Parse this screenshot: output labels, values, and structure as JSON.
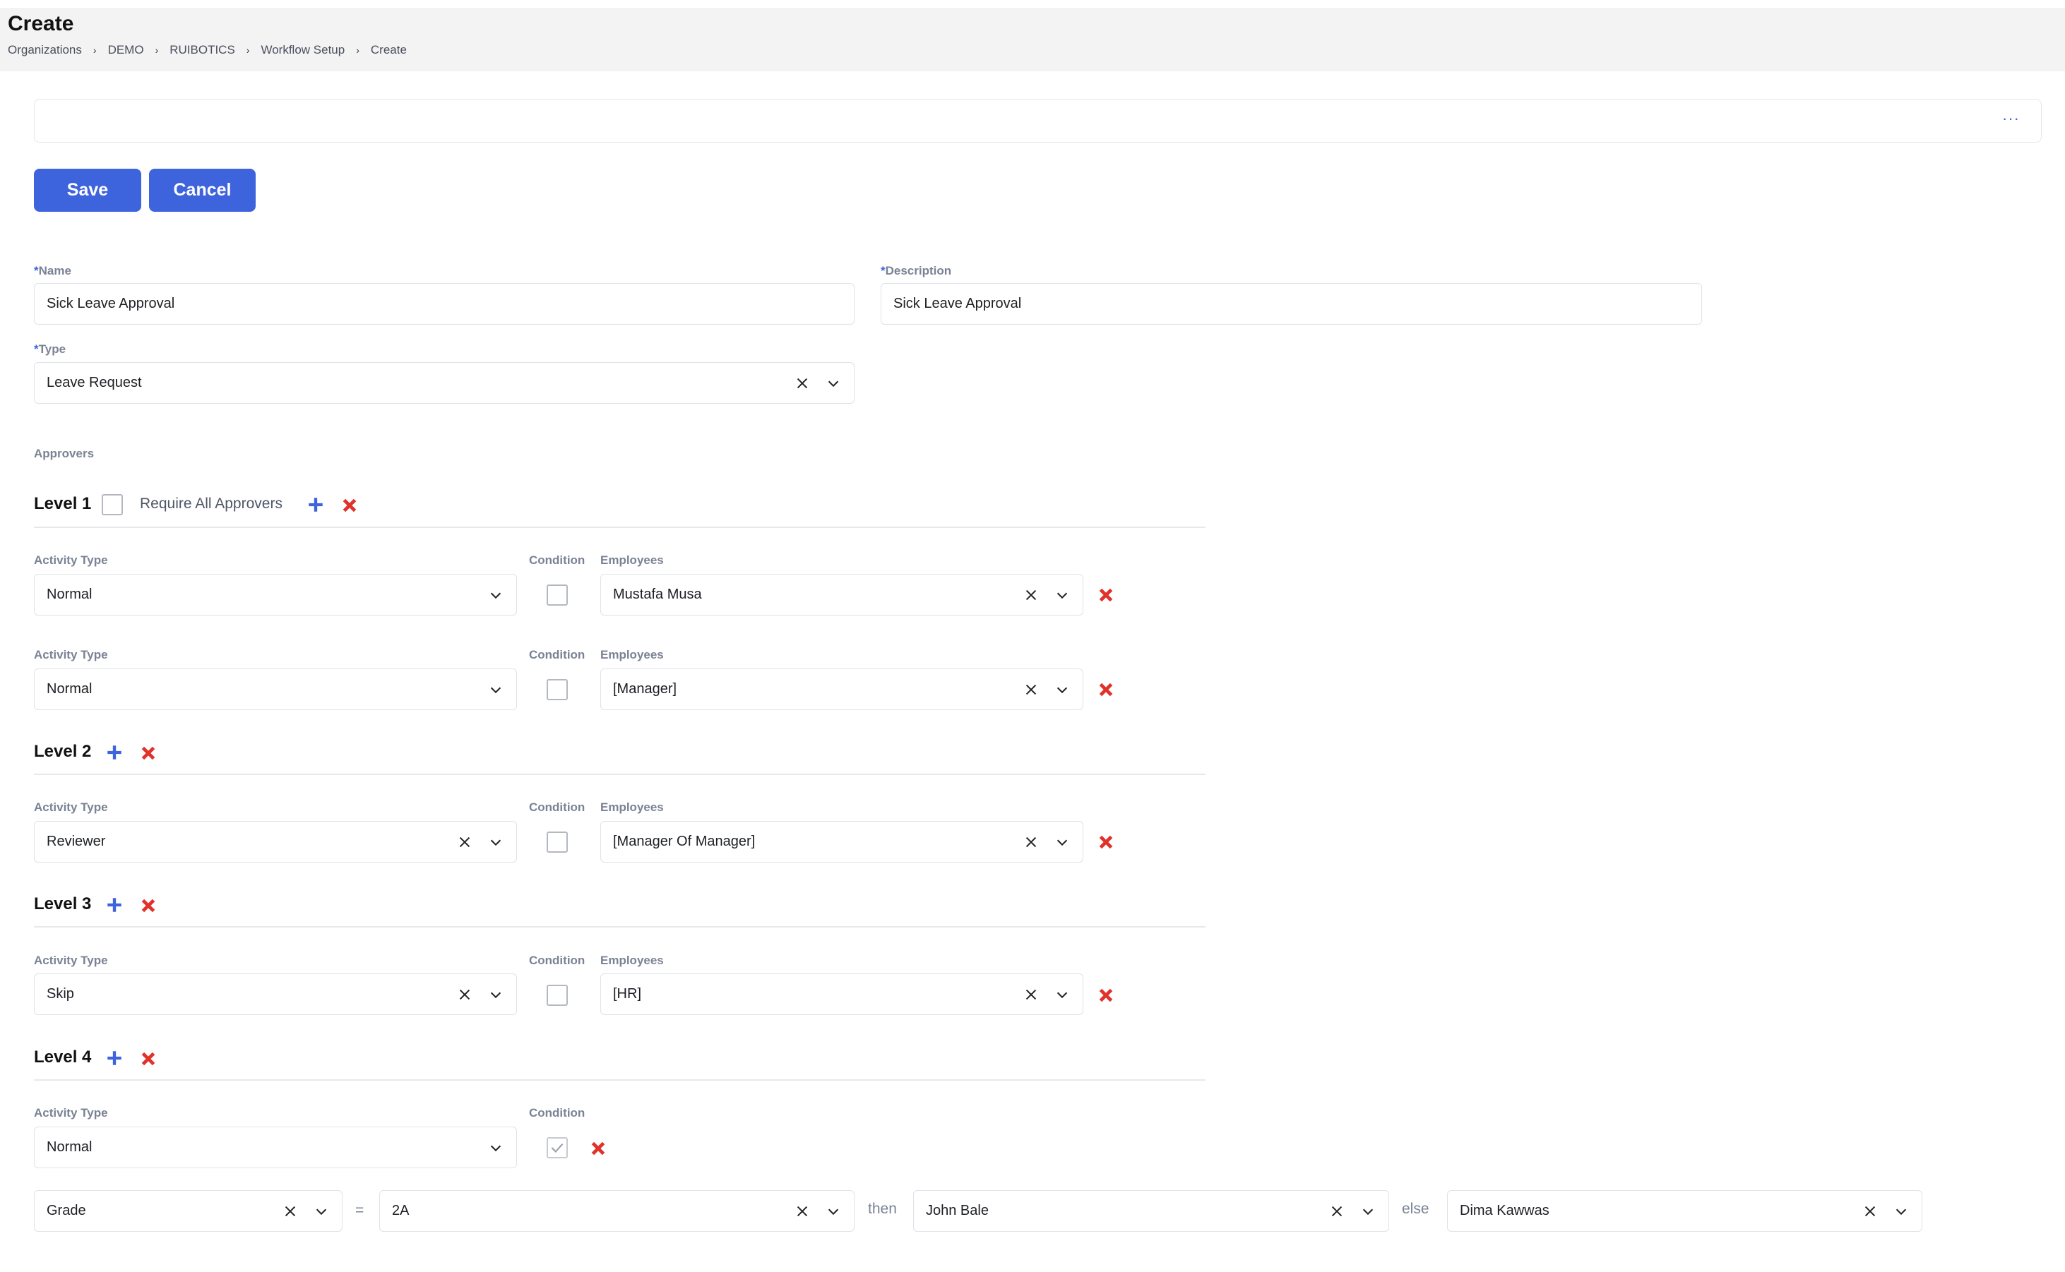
{
  "header": {
    "title": "Create",
    "breadcrumb": [
      "Organizations",
      "DEMO",
      "RUIBOTICS",
      "Workflow Setup",
      "Create"
    ]
  },
  "toolbar": {
    "more_label": "···",
    "save_label": "Save",
    "cancel_label": "Cancel"
  },
  "form": {
    "name_label": "Name",
    "name_value": "Sick Leave Approval",
    "description_label": "Description",
    "description_value": "Sick Leave Approval",
    "type_label": "Type",
    "type_value": "Leave Request",
    "required_mark": "*"
  },
  "approvers": {
    "section_label": "Approvers",
    "require_all_label": "Require All Approvers",
    "activity_type_label": "Activity Type",
    "condition_label": "Condition",
    "employees_label": "Employees",
    "levels": [
      {
        "title": "Level 1",
        "rows": [
          {
            "activity_type": "Normal",
            "employees": "Mustafa Musa"
          },
          {
            "activity_type": "Normal",
            "employees": "[Manager]"
          }
        ]
      },
      {
        "title": "Level 2",
        "rows": [
          {
            "activity_type": "Reviewer",
            "employees": "[Manager Of Manager]"
          }
        ]
      },
      {
        "title": "Level 3",
        "rows": [
          {
            "activity_type": "Skip",
            "employees": "[HR]"
          }
        ]
      },
      {
        "title": "Level 4",
        "rows": [
          {
            "activity_type": "Normal",
            "condition_checked": true
          }
        ]
      }
    ],
    "condition_rule": {
      "field": "Grade",
      "operator": "=",
      "value": "2A",
      "then_label": "then",
      "then_value": "John Bale",
      "else_label": "else",
      "else_value": "Dima Kawwas"
    }
  },
  "colors": {
    "accent": "#3d63dd",
    "danger": "#e0322a",
    "muted": "#7a8294"
  }
}
